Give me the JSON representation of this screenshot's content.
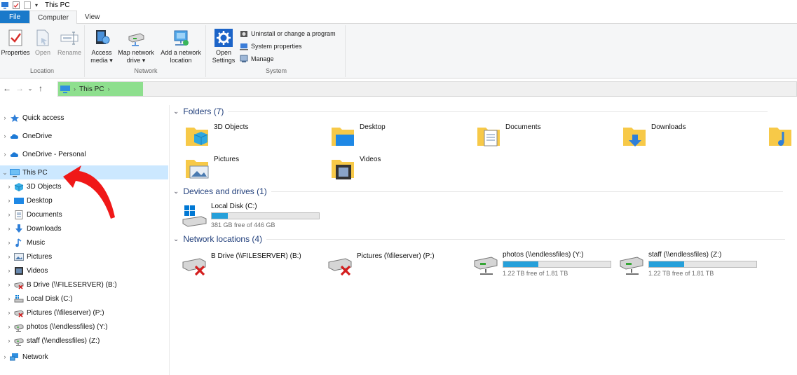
{
  "window": {
    "title": "This PC"
  },
  "ribbon_tabs": [
    "File",
    "Computer",
    "View"
  ],
  "ribbon": {
    "location": {
      "label": "Location",
      "buttons": [
        {
          "label": "Properties"
        },
        {
          "label": "Open"
        },
        {
          "label": "Rename"
        }
      ]
    },
    "network": {
      "label": "Network",
      "buttons": [
        {
          "line1": "Access",
          "line2": "media ▾"
        },
        {
          "line1": "Map network",
          "line2": "drive ▾"
        },
        {
          "line1": "Add a network",
          "line2": "location"
        }
      ]
    },
    "system": {
      "label": "System",
      "open_settings": {
        "line1": "Open",
        "line2": "Settings"
      },
      "small_buttons": [
        "Uninstall or change a program",
        "System properties",
        "Manage"
      ]
    }
  },
  "address": {
    "crumb": "This PC"
  },
  "nav": {
    "items": [
      {
        "label": "Quick access",
        "icon": "star-icon"
      },
      {
        "label": "OneDrive",
        "icon": "cloud-icon"
      },
      {
        "label": "OneDrive - Personal",
        "icon": "cloud-icon"
      },
      {
        "label": "This PC",
        "icon": "pc-icon"
      },
      {
        "label": "3D Objects",
        "icon": "cube-icon"
      },
      {
        "label": "Desktop",
        "icon": "desktop-icon"
      },
      {
        "label": "Documents",
        "icon": "documents-icon"
      },
      {
        "label": "Downloads",
        "icon": "downloads-icon"
      },
      {
        "label": "Music",
        "icon": "music-icon"
      },
      {
        "label": "Pictures",
        "icon": "pictures-icon"
      },
      {
        "label": "Videos",
        "icon": "videos-icon"
      },
      {
        "label": "B Drive (\\\\FILESERVER) (B:)",
        "icon": "disconnected-drive-icon"
      },
      {
        "label": "Local Disk (C:)",
        "icon": "local-disk-icon"
      },
      {
        "label": "Pictures (\\\\fileserver) (P:)",
        "icon": "disconnected-drive-icon"
      },
      {
        "label": "photos (\\\\endlessfiles) (Y:)",
        "icon": "network-drive-icon"
      },
      {
        "label": "staff (\\\\endlessfiles) (Z:)",
        "icon": "network-drive-icon"
      },
      {
        "label": "Network",
        "icon": "network-icon"
      }
    ]
  },
  "content": {
    "folders": {
      "header": "Folders (7)",
      "items": [
        {
          "label": "3D Objects"
        },
        {
          "label": "Desktop"
        },
        {
          "label": "Documents"
        },
        {
          "label": "Downloads"
        },
        {
          "label": "Pictures"
        },
        {
          "label": "Videos"
        }
      ]
    },
    "devices": {
      "header": "Devices and drives (1)",
      "items": [
        {
          "label": "Local Disk (C:)",
          "free": "381 GB free of 446 GB",
          "used_fraction": 0.15
        }
      ]
    },
    "network": {
      "header": "Network locations (4)",
      "items": [
        {
          "label": "B Drive (\\\\FILESERVER) (B:)"
        },
        {
          "label": "Pictures (\\\\fileserver) (P:)"
        },
        {
          "label": "photos (\\\\endlessfiles) (Y:)",
          "free": "1.22 TB free of 1.81 TB",
          "used_fraction": 0.33
        },
        {
          "label": "staff (\\\\endlessfiles) (Z:)",
          "free": "1.22 TB free of 1.81 TB",
          "used_fraction": 0.33
        }
      ]
    }
  },
  "colors": {
    "accent": "#1979ca",
    "selection": "#cce8ff",
    "bar_fill": "#26a0da",
    "arrow": "#f01818"
  }
}
